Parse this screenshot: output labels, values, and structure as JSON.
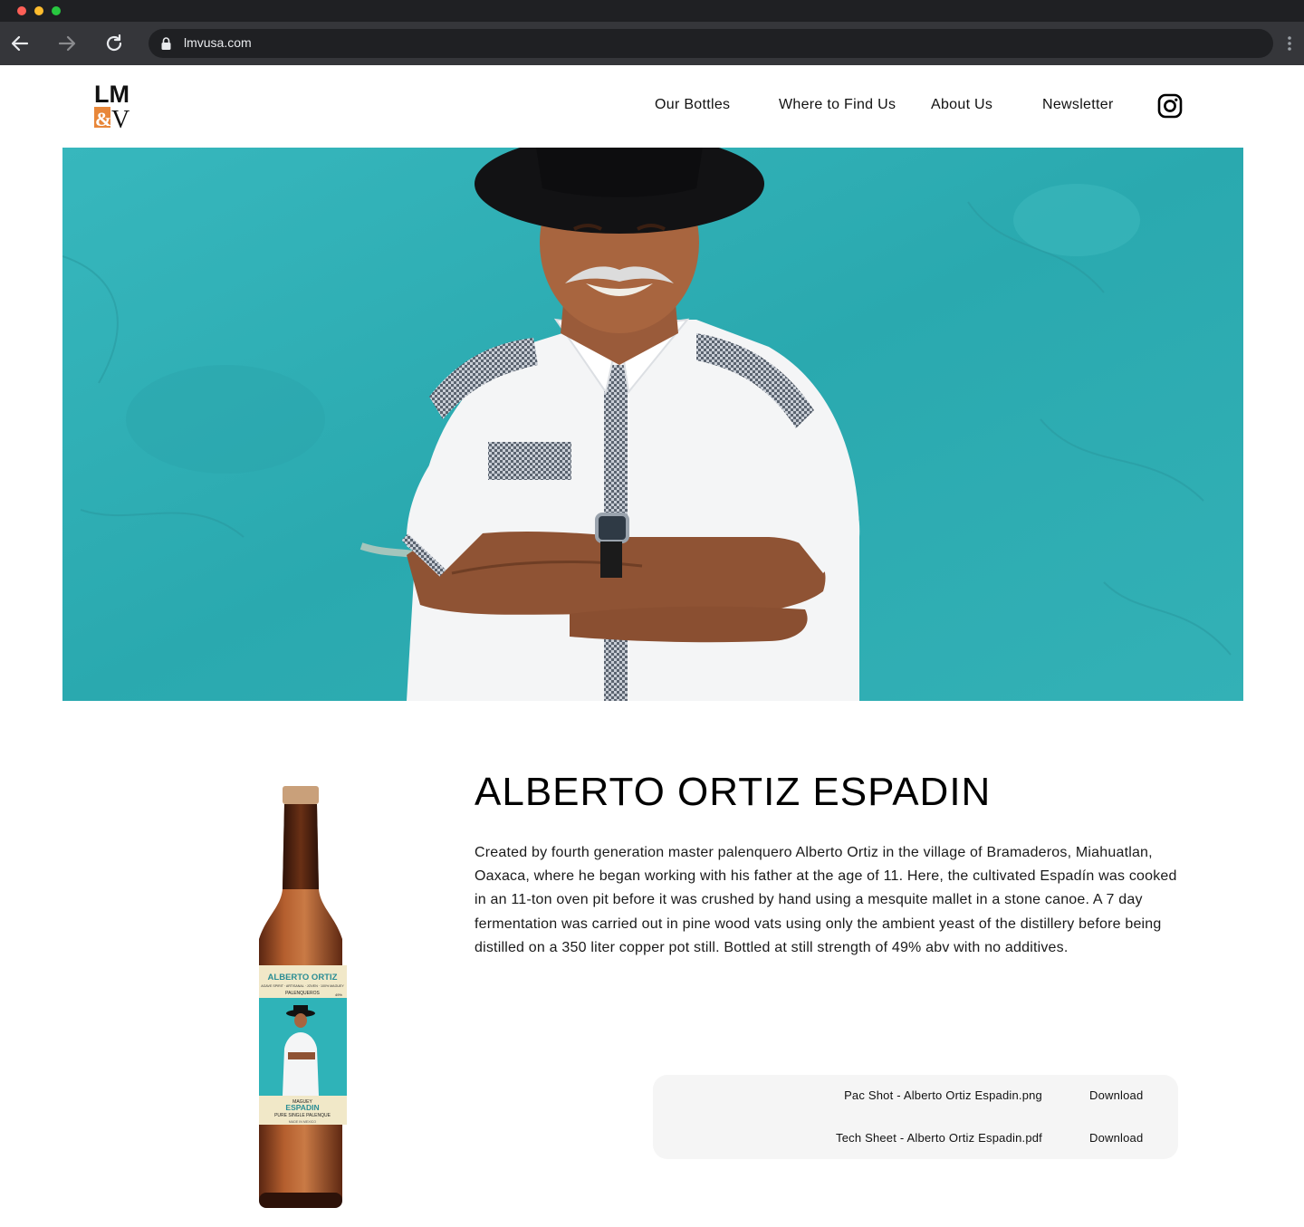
{
  "browser": {
    "url": "lmvusa.com"
  },
  "header": {
    "logo_alt": "LM&V",
    "nav": [
      {
        "label": "Our Bottles"
      },
      {
        "label": "Where to Find Us"
      },
      {
        "label": "About Us"
      },
      {
        "label": "Newsletter"
      }
    ],
    "social_icon": "instagram-icon"
  },
  "product": {
    "title": "ALBERTO ORTIZ ESPADIN",
    "description": "Created by fourth generation master palenquero Alberto Ortiz in the village of Bramaderos, Miahuatlan, Oaxaca, where he began working with his father at the age of 11. Here, the cultivated Espadín was cooked in an 11-ton oven pit before it was crushed by hand using a mesquite mallet in a stone canoe. A 7 day fermentation was carried out in pine wood vats using only the ambient yeast of the distillery before  being distilled on a 350 liter copper pot still. Bottled at still strength of 49% abv with no additives.",
    "bottle_label": {
      "name": "ALBERTO ORTIZ",
      "subline": "AGAVE SPIRIT · ARTISANAL · JOVEN · 100% MAGUEY",
      "brand": "PALENQUEROS",
      "abv": "49%",
      "maguey": "MAGUEY",
      "variety": "ESPADIN",
      "type": "PURE SINGLE PALENQUE",
      "origin": "MADE IN MEXICO"
    }
  },
  "downloads": [
    {
      "file": "Pac Shot - Alberto Ortiz Espadin.png",
      "action": "Download"
    },
    {
      "file": "Tech Sheet - Alberto Ortiz Espadin.pdf",
      "action": "Download"
    }
  ],
  "colors": {
    "hero_bg": "#2fb3b8",
    "logo_orange": "#e8873a",
    "download_bg": "#f5f5f5"
  }
}
